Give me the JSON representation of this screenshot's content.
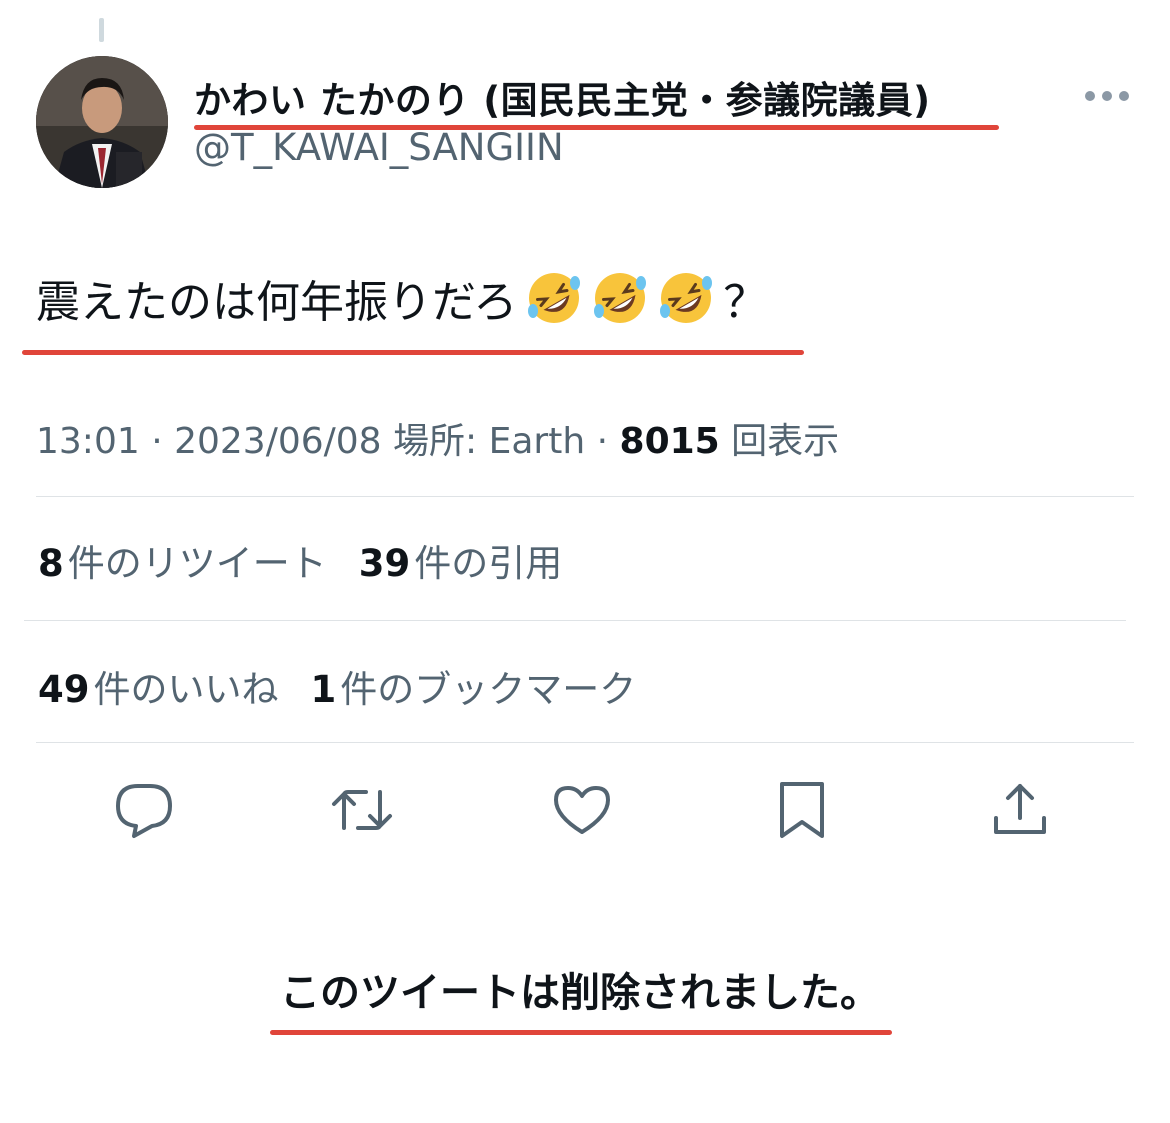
{
  "author": {
    "display_name": "かわい たかのり (国民民主党・参議院議員)",
    "handle": "@T_KAWAI_SANGIIN"
  },
  "tweet": {
    "text": "震えたのは何年振りだろ",
    "emoji": [
      "rolling-on-floor-laughing",
      "rolling-on-floor-laughing",
      "rolling-on-floor-laughing"
    ],
    "text_suffix": "？"
  },
  "meta": {
    "time": "13:01",
    "separator": " · ",
    "date": "2023/06/08",
    "location_label": "場所: ",
    "location": "Earth",
    "views_count": "8015",
    "views_label": "回表示"
  },
  "stats": {
    "retweets": {
      "count": "8",
      "label": "件のリツイート"
    },
    "quotes": {
      "count": "39",
      "label": "件の引用"
    },
    "likes": {
      "count": "49",
      "label": "件のいいね"
    },
    "bookmarks": {
      "count": "1",
      "label": "件のブックマーク"
    }
  },
  "actions": [
    "reply-icon",
    "retweet-icon",
    "like-icon",
    "bookmark-icon",
    "share-icon"
  ],
  "deleted_notice": "このツイートは削除されました。",
  "colors": {
    "text": "#0f1419",
    "secondary": "#536471",
    "underline": "#e0453a",
    "divider": "#dfe3e6"
  }
}
